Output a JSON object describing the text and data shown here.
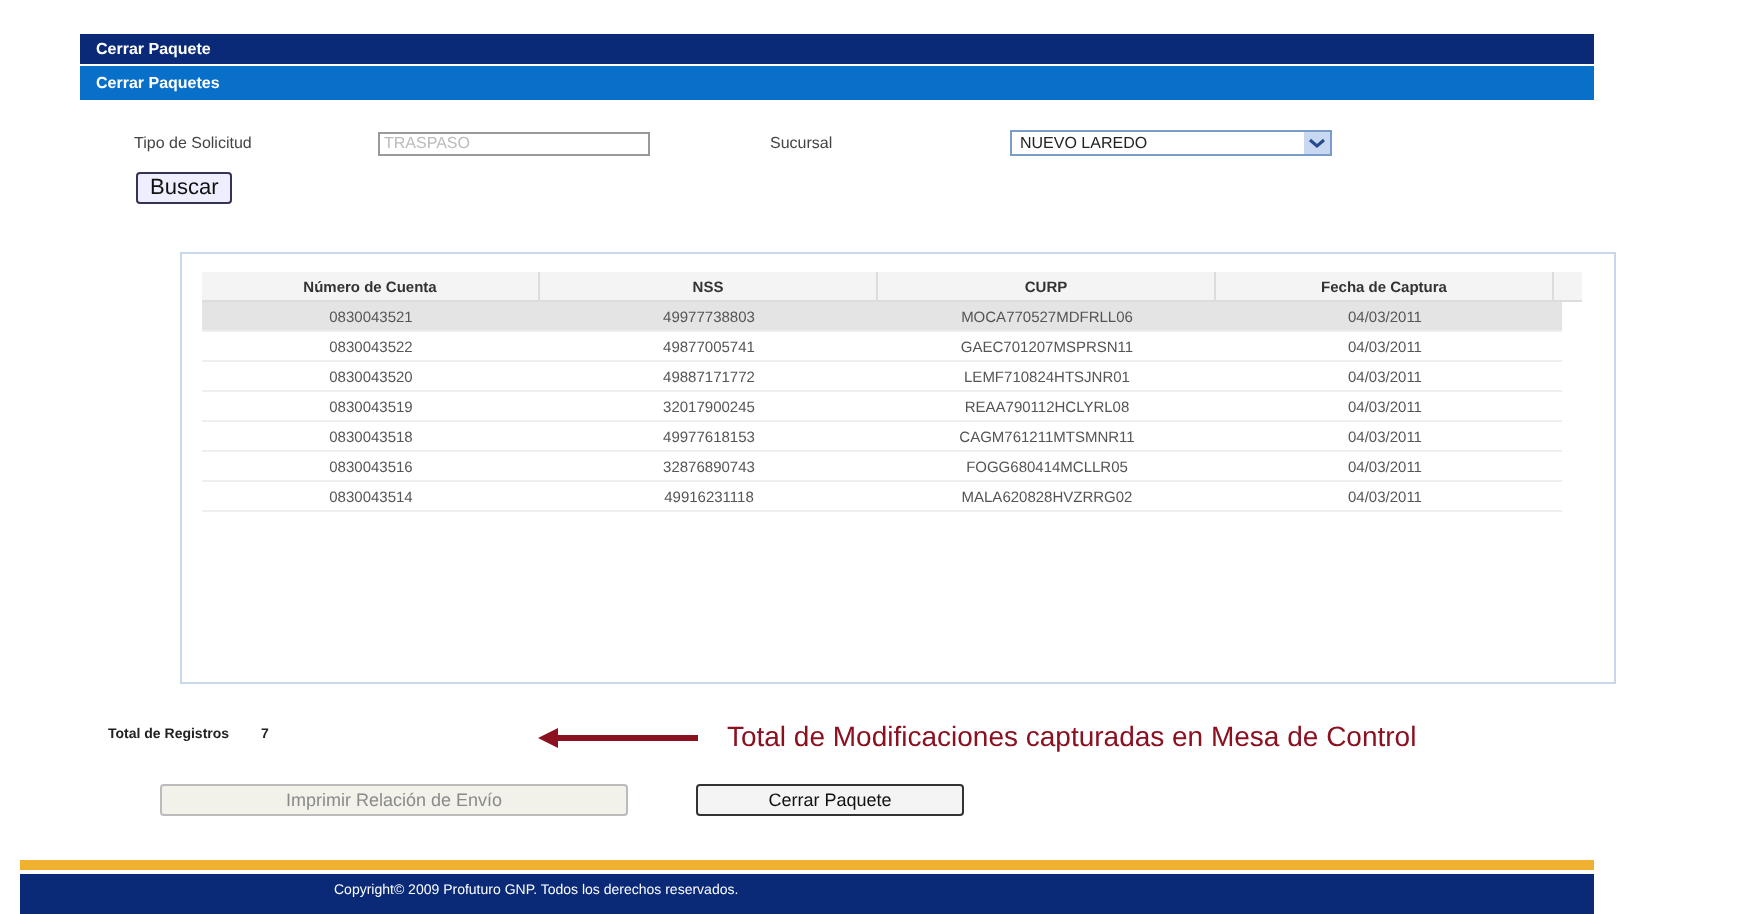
{
  "header": {
    "title": "Cerrar Paquete",
    "subtitle": "Cerrar Paquetes"
  },
  "form": {
    "tipo_label": "Tipo de Solicitud",
    "tipo_value": "TRASPASO",
    "sucursal_label": "Sucursal",
    "sucursal_value": "NUEVO LAREDO",
    "search_button": "Buscar"
  },
  "table": {
    "columns": [
      "Número de Cuenta",
      "NSS",
      "CURP",
      "Fecha de Captura"
    ],
    "rows": [
      {
        "cells": [
          "0830043521",
          "49977738803",
          "MOCA770527MDFRLL06",
          "04/03/2011"
        ],
        "selected": true
      },
      {
        "cells": [
          "0830043522",
          "49877005741",
          "GAEC701207MSPRSN11",
          "04/03/2011"
        ],
        "selected": false
      },
      {
        "cells": [
          "0830043520",
          "49887171772",
          "LEMF710824HTSJNR01",
          "04/03/2011"
        ],
        "selected": false
      },
      {
        "cells": [
          "0830043519",
          "32017900245",
          "REAA790112HCLYRL08",
          "04/03/2011"
        ],
        "selected": false
      },
      {
        "cells": [
          "0830043518",
          "49977618153",
          "CAGM761211MTSMNR11",
          "04/03/2011"
        ],
        "selected": false
      },
      {
        "cells": [
          "0830043516",
          "32876890743",
          "FOGG680414MCLLR05",
          "04/03/2011"
        ],
        "selected": false
      },
      {
        "cells": [
          "0830043514",
          "49916231118",
          "MALA620828HVZRRG02",
          "04/03/2011"
        ],
        "selected": false
      }
    ]
  },
  "total": {
    "label": "Total de Registros",
    "value": "7"
  },
  "annotation": "Total de Modificaciones capturadas en Mesa de Control",
  "buttons": [
    {
      "label": "Imprimir Relación de Envío",
      "disabled": true
    },
    {
      "label": "Cerrar Paquete",
      "disabled": false
    }
  ],
  "footer": "Copyright© 2009 Profuturo GNP. Todos los derechos reservados."
}
